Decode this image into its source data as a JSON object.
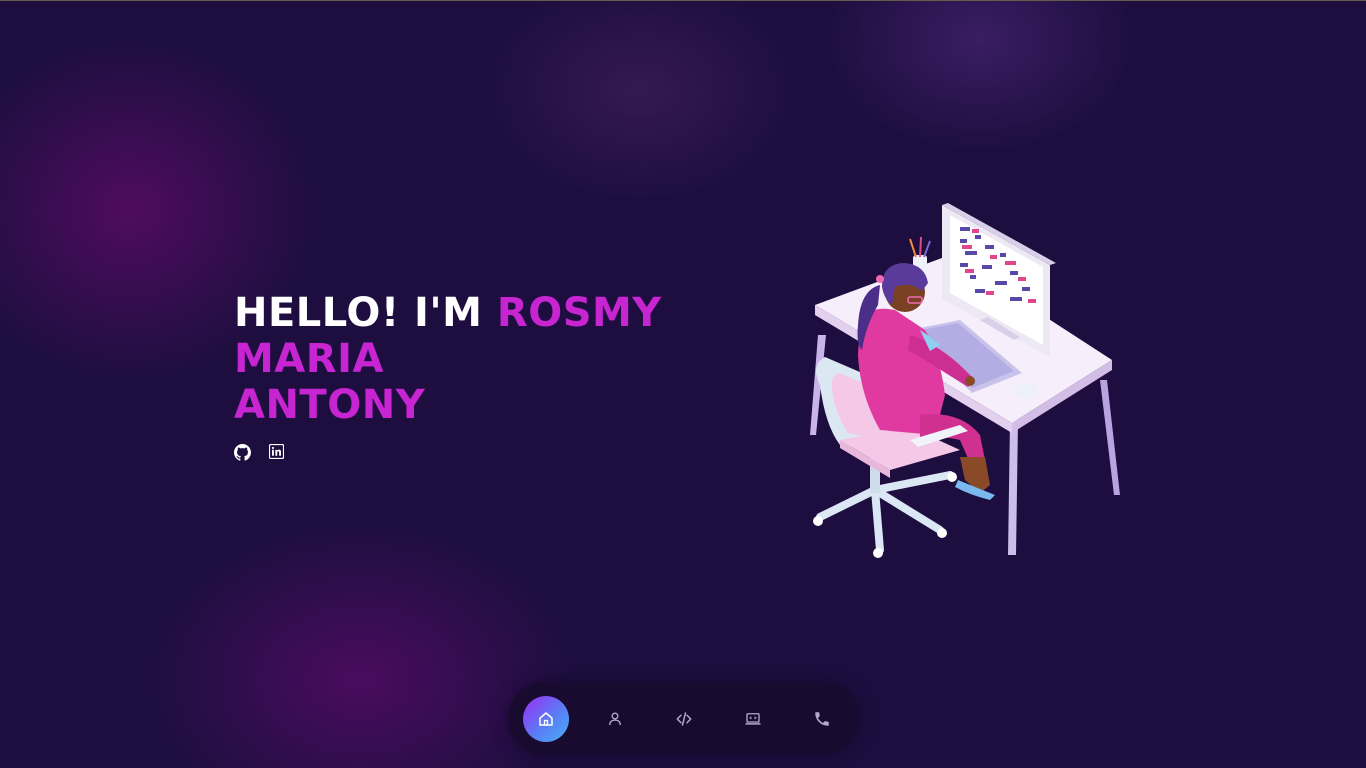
{
  "hero": {
    "greeting": "HELLO! I'M ",
    "name_line1": "ROSMY MARIA",
    "name_line2": "ANTONY"
  },
  "socials": [
    {
      "icon": "github-icon"
    },
    {
      "icon": "linkedin-icon"
    }
  ],
  "nav": {
    "items": [
      {
        "icon": "home-icon",
        "active": true
      },
      {
        "icon": "user-icon",
        "active": false
      },
      {
        "icon": "code-icon",
        "active": false
      },
      {
        "icon": "laptop-code-icon",
        "active": false
      },
      {
        "icon": "phone-icon",
        "active": false
      }
    ]
  },
  "colors": {
    "background": "#1e0e40",
    "accent": "#c724d2",
    "nav_background": "#190a30",
    "nav_active_gradient": [
      "#9a2cf0",
      "#45b0f5"
    ]
  }
}
